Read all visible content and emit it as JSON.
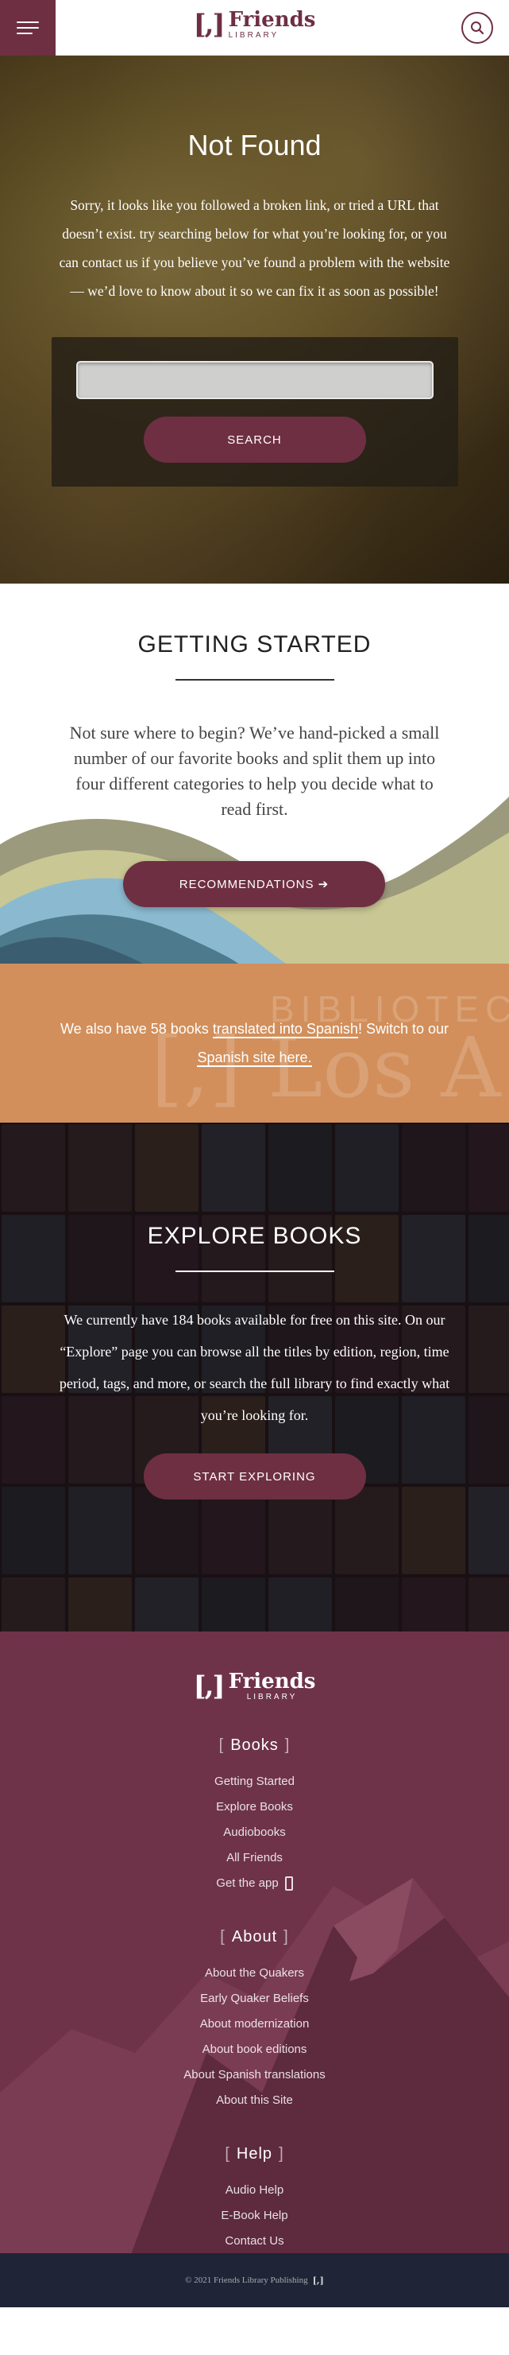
{
  "header": {
    "logo_mark": "[,]",
    "logo_word": "Friends",
    "logo_sub": "LIBRARY"
  },
  "not_found": {
    "title": "Not Found",
    "text": "Sorry, it looks like you followed a broken link, or tried a URL that doesn’t exist. try searching below for what you’re looking for, or you can contact us if you believe you’ve found a problem with the website — we’d love to know about it so we can fix it as soon as possible!",
    "search_value": "",
    "search_button": "SEARCH"
  },
  "getting_started": {
    "title": "GETTING STARTED",
    "text": "Not sure where to begin? We’ve hand-picked a small number of our favorite books and split them up into four different categories to help you decide what to read first.",
    "button": "RECOMMENDATIONS ➔"
  },
  "spanish": {
    "bg_line1": "BIBLIOTECA",
    "bg_line2": "[,] Los A",
    "text_before": "We also have 58 books ",
    "text_underlined": "translated into Spanish",
    "text_after": "! Switch to our",
    "link": "Spanish site here."
  },
  "explore": {
    "title": "EXPLORE BOOKS",
    "text": "We currently have 184 books available for free on this site. On our “Explore” page you can browse all the titles by edition, region, time period, tags, and more, or search the full library to find exactly what you’re looking for.",
    "button": "START EXPLORING"
  },
  "footer": {
    "sections": [
      {
        "title": "Books",
        "links": [
          "Getting Started",
          "Explore Books",
          "Audiobooks",
          "All Friends",
          "Get the app"
        ]
      },
      {
        "title": "About",
        "links": [
          "About the Quakers",
          "Early Quaker Beliefs",
          "About modernization",
          "About book editions",
          "About Spanish translations",
          "About this Site"
        ]
      },
      {
        "title": "Help",
        "links": [
          "Audio Help",
          "E-Book Help",
          "Contact Us"
        ]
      }
    ],
    "copyright": "© 2021 Friends Library Publishing",
    "copyright_mark": "[,]"
  },
  "colors": {
    "brand_maroon": "#6e2f43",
    "spanish_orange": "#d28f5b",
    "footer_bg": "#6e3349",
    "copyright_bg": "#1f2436"
  },
  "icons": [
    "menu-icon",
    "search-icon",
    "phone-icon"
  ]
}
